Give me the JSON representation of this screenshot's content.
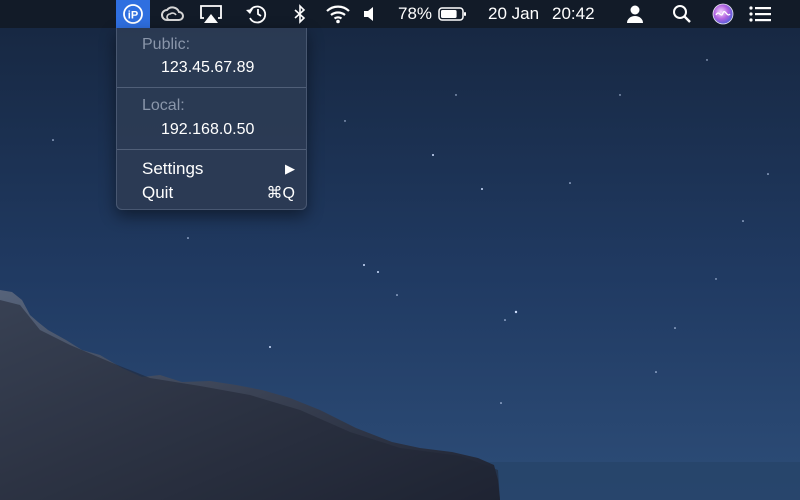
{
  "menubar": {
    "battery_percent": "78%",
    "date": "20 Jan",
    "time": "20:42"
  },
  "ip_menu": {
    "public_label": "Public:",
    "public_ip": "123.45.67.89",
    "local_label": "Local:",
    "local_ip": "192.168.0.50",
    "settings_label": "Settings",
    "settings_arrow": "▶",
    "quit_label": "Quit",
    "quit_shortcut": "⌘Q"
  },
  "colors": {
    "ip_app_highlight": "#2f6fe0",
    "menu_background": "#2c3b54",
    "menu_label_dim": "#8a96aa"
  },
  "icons": {
    "ip_app": "ip-icon",
    "creative_cloud": "creative-cloud-icon",
    "airplay": "airplay-icon",
    "time_machine": "time-machine-icon",
    "bluetooth": "bluetooth-icon",
    "wifi": "wifi-icon",
    "volume": "volume-icon",
    "battery": "battery-icon",
    "user": "user-icon",
    "spotlight": "search-icon",
    "siri": "siri-icon",
    "notification_center": "list-icon"
  },
  "battery_level": 0.78
}
